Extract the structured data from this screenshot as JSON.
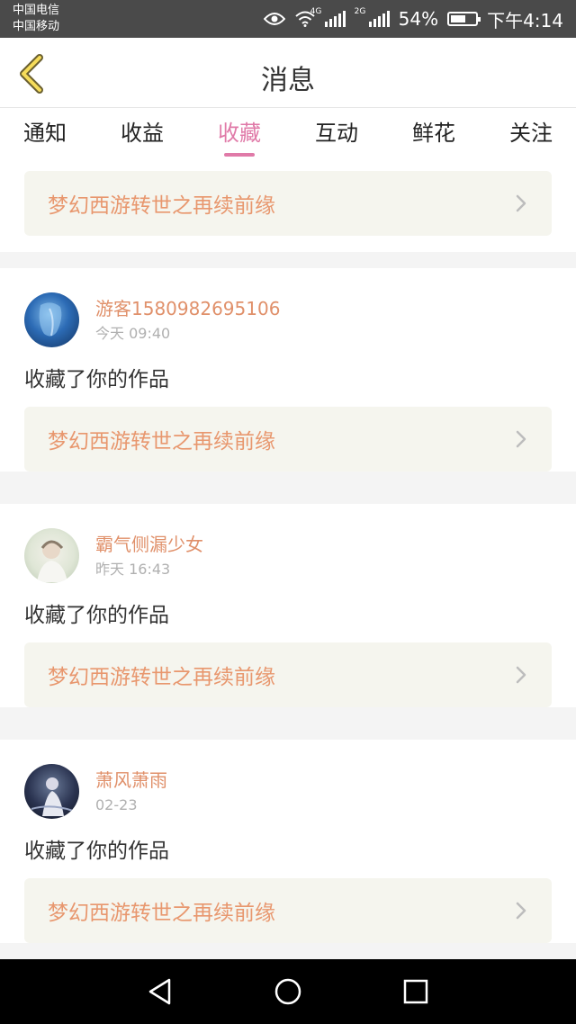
{
  "status_bar": {
    "carrier_1": "中国电信",
    "carrier_2": "中国移动",
    "network_1": "4G",
    "network_2": "2G",
    "battery": "54%",
    "time": "下午4:14"
  },
  "header": {
    "title": "消息",
    "back_icon": "chevron-left-icon"
  },
  "tabs": [
    {
      "label": "通知",
      "active": false
    },
    {
      "label": "收益",
      "active": false
    },
    {
      "label": "收藏",
      "active": true
    },
    {
      "label": "互动",
      "active": false
    },
    {
      "label": "鲜花",
      "active": false
    },
    {
      "label": "关注",
      "active": false
    }
  ],
  "top_work": {
    "title": "梦幻西游转世之再续前缘"
  },
  "items": [
    {
      "username": "游客1580982695106",
      "time": "今天 09:40",
      "message": "收藏了你的作品",
      "work_title": "梦幻西游转世之再续前缘"
    },
    {
      "username": "霸气侧漏少女",
      "time": "昨天 16:43",
      "message": "收藏了你的作品",
      "work_title": "梦幻西游转世之再续前缘"
    },
    {
      "username": "萧风萧雨",
      "time": "02-23",
      "message": "收藏了你的作品",
      "work_title": "梦幻西游转世之再续前缘"
    }
  ],
  "colors": {
    "accent": "#e07aa8",
    "username": "#e0906a",
    "work_title": "#e8976e"
  }
}
